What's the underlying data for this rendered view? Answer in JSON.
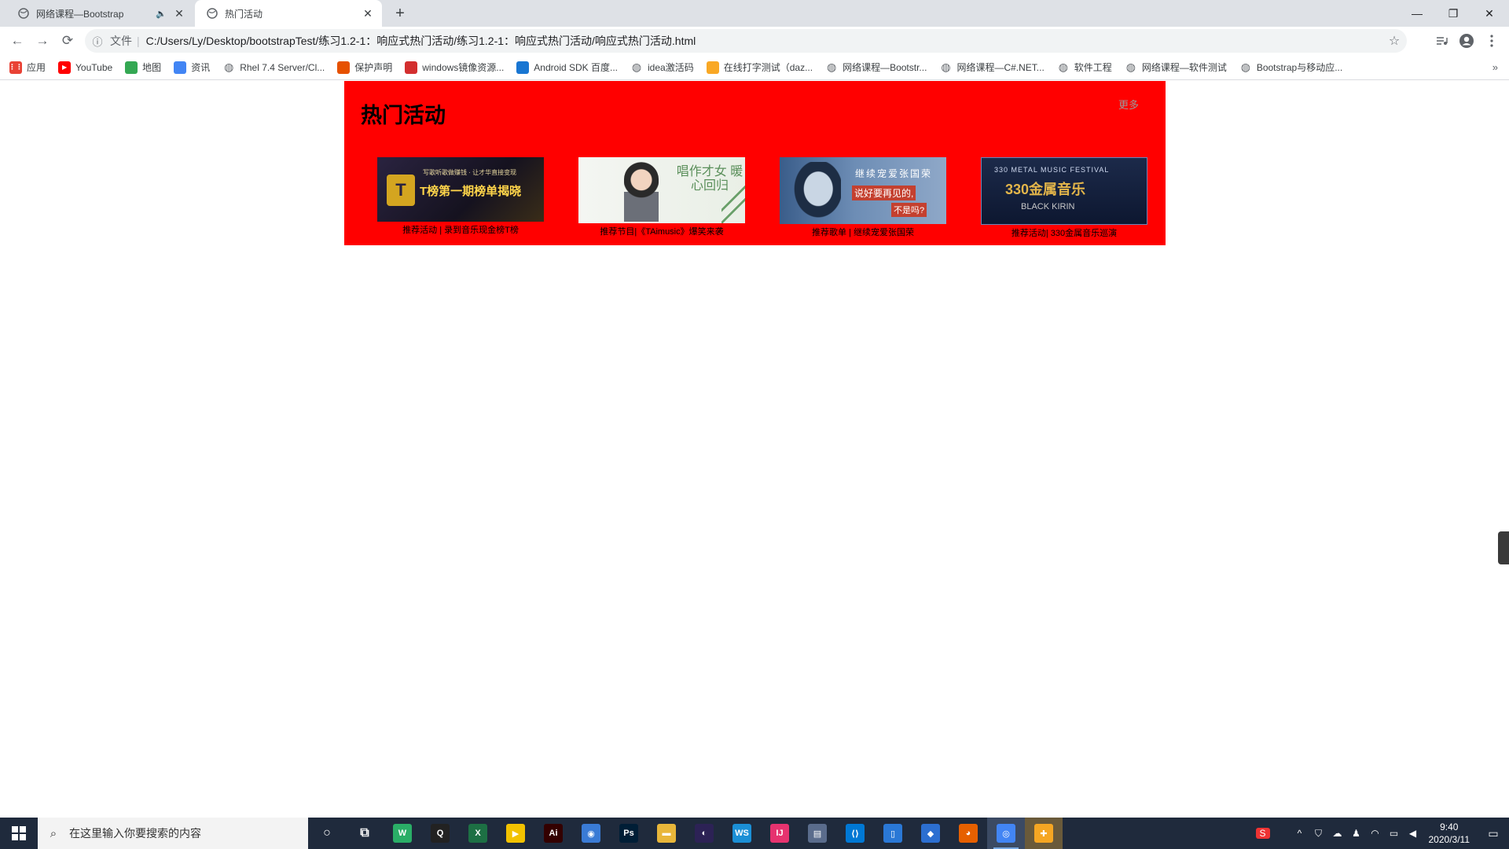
{
  "browser": {
    "tabs": [
      {
        "title": "网络课程—Bootstrap",
        "audio_icon": "speaker-icon",
        "active": false
      },
      {
        "title": "热门活动",
        "active": true
      }
    ],
    "new_tab_label": "+",
    "window_controls": {
      "minimize": "—",
      "restore": "❐",
      "close": "✕"
    },
    "nav": {
      "back": "←",
      "forward": "→",
      "reload": "⟳"
    },
    "omnibox": {
      "info": "ⓘ",
      "scheme": "文件",
      "separator": "|",
      "url": "C:/Users/Ly/Desktop/bootstrapTest/练习1.2-1：响应式热门活动/练习1.2-1：响应式热门活动/响应式热门活动.html",
      "star": "☆"
    },
    "bookmarks": [
      {
        "label": "应用",
        "icon": "apps-grid-icon",
        "color": "#e94235"
      },
      {
        "label": "YouTube",
        "icon": "youtube-icon",
        "color": "#ff0000"
      },
      {
        "label": "地图",
        "icon": "maps-icon",
        "color": "#34a853"
      },
      {
        "label": "资讯",
        "icon": "news-icon",
        "color": "#4285f4"
      },
      {
        "label": "Rhel 7.4 Server/Cl...",
        "icon": "globe-icon",
        "color": "#5f6368"
      },
      {
        "label": "保护声明",
        "icon": "shield-icon",
        "color": "#e65100"
      },
      {
        "label": "windows镜像资源...",
        "icon": "c-icon",
        "color": "#d32f2f"
      },
      {
        "label": "Android SDK 百度...",
        "icon": "filter-icon",
        "color": "#1976d2"
      },
      {
        "label": "idea激活码",
        "icon": "globe-icon",
        "color": "#5f6368"
      },
      {
        "label": "在线打字测试（daz...",
        "icon": "fire-icon",
        "color": "#f9a825"
      },
      {
        "label": "网络课程—Bootstr...",
        "icon": "globe-icon",
        "color": "#5f6368"
      },
      {
        "label": "网络课程—C#.NET...",
        "icon": "globe-icon",
        "color": "#5f6368"
      },
      {
        "label": "软件工程",
        "icon": "globe-icon",
        "color": "#5f6368"
      },
      {
        "label": "网络课程—软件测试",
        "icon": "globe-icon",
        "color": "#5f6368"
      },
      {
        "label": "Bootstrap与移动应...",
        "icon": "globe-icon",
        "color": "#5f6368"
      }
    ],
    "bookmarks_more": "»"
  },
  "page": {
    "panel_color": "#ff0000",
    "title": "热门活动",
    "more": "更多",
    "cards": [
      {
        "caption": "推荐活动 | 录到音乐现金榜T榜",
        "banner_main": "T榜第一期榜单揭晓",
        "banner_sub": "写歌听歌做赚钱 · 让才华直接变现",
        "logo": "T"
      },
      {
        "caption": "推荐节目|《TAimusic》爆笑来袭",
        "banner_main": "唱作才女 暖心回归"
      },
      {
        "caption": "推荐歌单 | 继续宠爱张国荣",
        "banner_line1": "继续宠爱张国荣",
        "banner_line2": "说好要再见的,",
        "banner_line3": "不是吗?"
      },
      {
        "caption": "推荐活动| 330金属音乐巡演",
        "banner_top": "330 METAL MUSIC FESTIVAL",
        "banner_main": "330金属音乐",
        "banner_bot": "BLACK KIRIN"
      }
    ]
  },
  "taskbar": {
    "search_placeholder": "在这里输入你要搜索的内容",
    "apps": [
      {
        "name": "cortana-icon",
        "glyph": "○",
        "color": "transparent"
      },
      {
        "name": "task-view-icon",
        "glyph": "⧉",
        "color": "transparent"
      },
      {
        "name": "wechat-icon",
        "glyph": "W",
        "color": "#2aae67"
      },
      {
        "name": "qq-icon",
        "glyph": "Q",
        "color": "#222222"
      },
      {
        "name": "excel-icon",
        "glyph": "X",
        "color": "#1d7044"
      },
      {
        "name": "potplayer-icon",
        "glyph": "▶",
        "color": "#f2c200"
      },
      {
        "name": "illustrator-icon",
        "glyph": "Ai",
        "color": "#330000"
      },
      {
        "name": "baidu-netdisk-icon",
        "glyph": "◉",
        "color": "#3a7bd5"
      },
      {
        "name": "photoshop-icon",
        "glyph": "Ps",
        "color": "#001e36"
      },
      {
        "name": "file-explorer-icon",
        "glyph": "▬",
        "color": "#e8b63a"
      },
      {
        "name": "eclipse-icon",
        "glyph": "◐",
        "color": "#2c2255"
      },
      {
        "name": "webstorm-icon",
        "glyph": "WS",
        "color": "#1b8fd6"
      },
      {
        "name": "intellij-icon",
        "glyph": "IJ",
        "color": "#e6336f"
      },
      {
        "name": "document-icon",
        "glyph": "▤",
        "color": "#5a6c8c"
      },
      {
        "name": "vscode-icon",
        "glyph": "⟨⟩",
        "color": "#0078d4"
      },
      {
        "name": "phone-icon",
        "glyph": "▯",
        "color": "#2a78d6"
      },
      {
        "name": "security-icon",
        "glyph": "◆",
        "color": "#2c6fd1"
      },
      {
        "name": "firefox-icon",
        "glyph": "◕",
        "color": "#e66000"
      },
      {
        "name": "chrome-icon",
        "glyph": "◎",
        "color": "#4285f4"
      },
      {
        "name": "shield-app-icon",
        "glyph": "✚",
        "color": "#f5a623"
      }
    ],
    "tray": {
      "sogou": "S",
      "chevron": "^",
      "time": "9:40",
      "date": "2020/3/11",
      "notification": "▭"
    }
  }
}
